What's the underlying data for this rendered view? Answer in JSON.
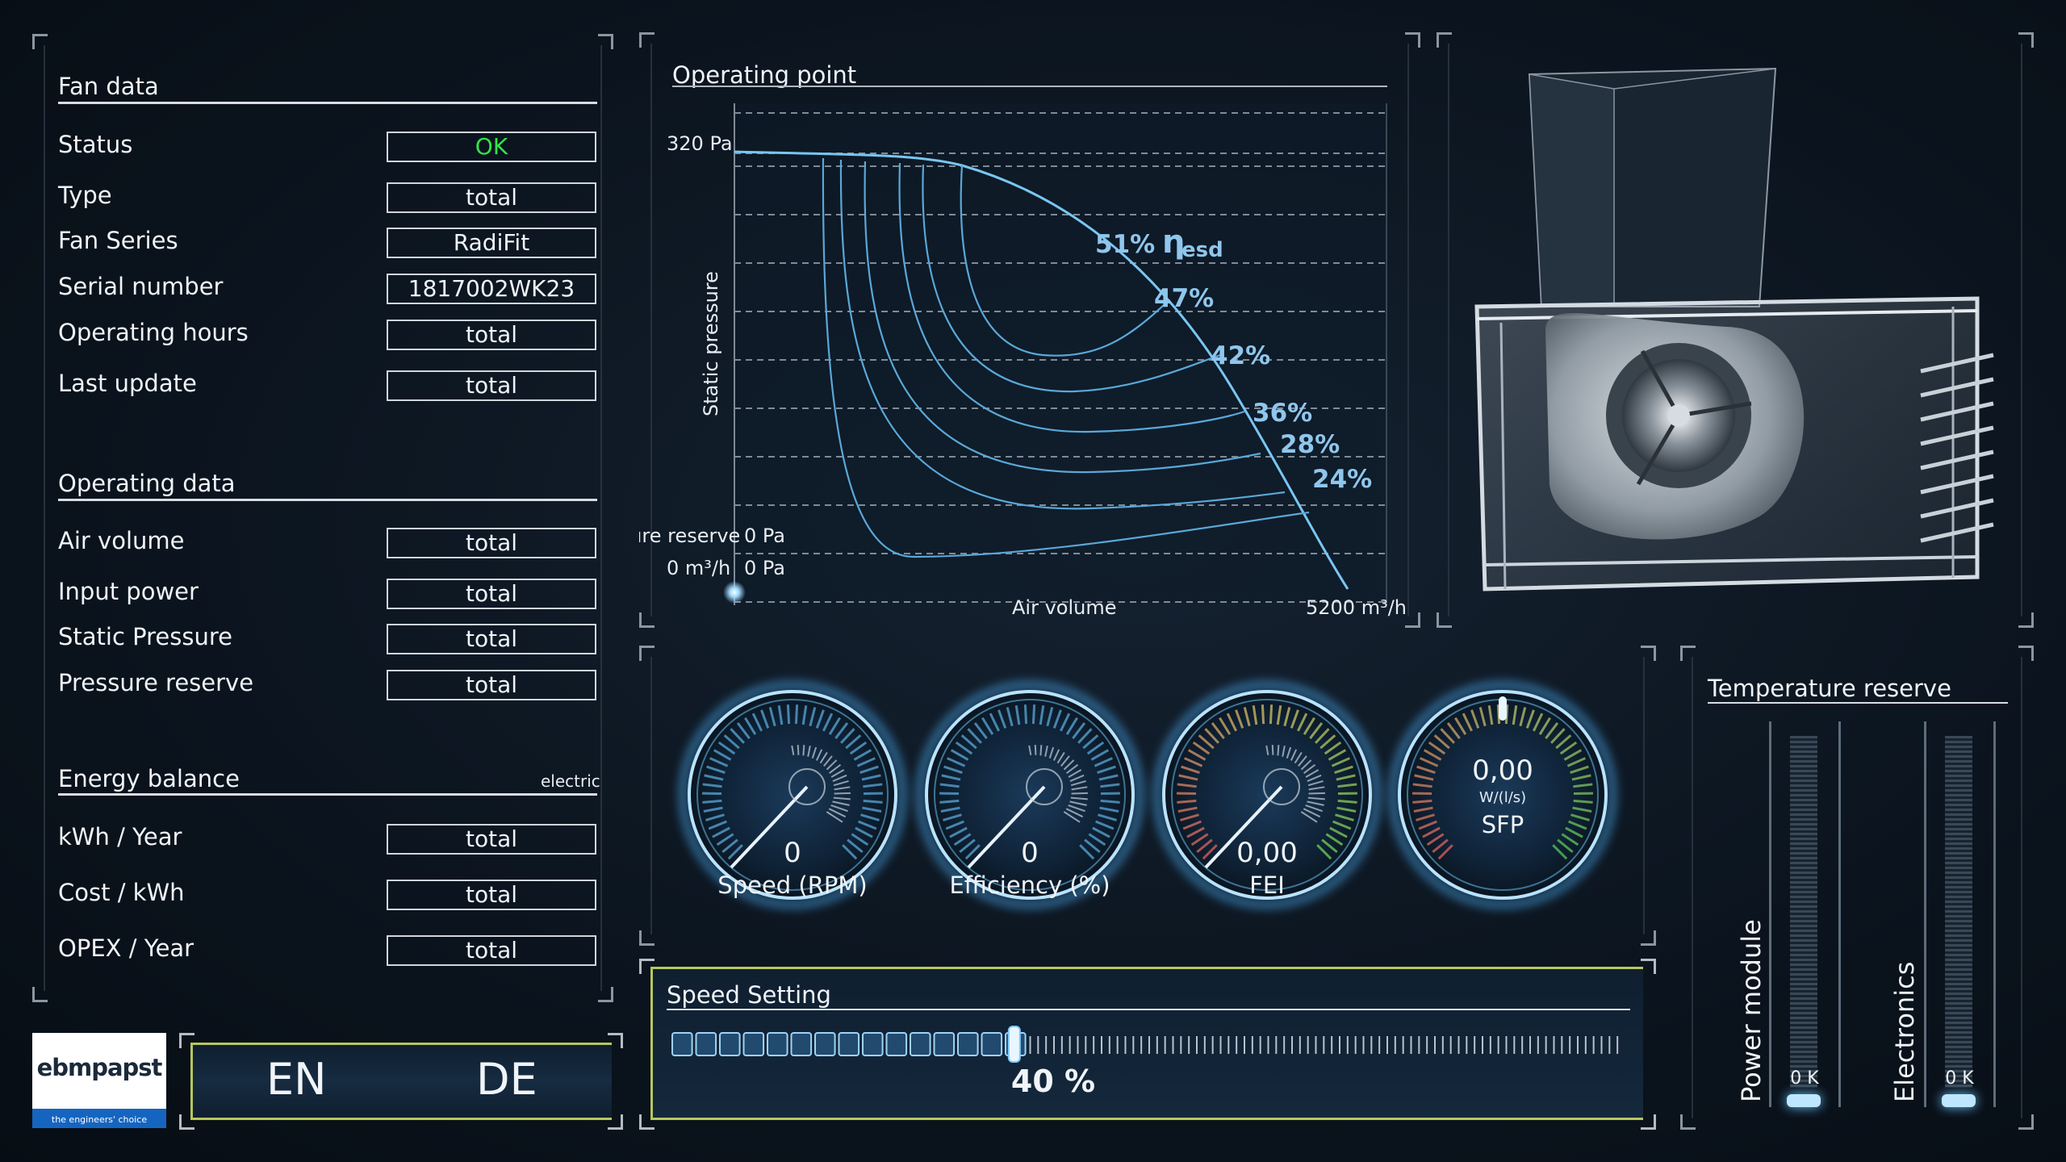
{
  "fan_data": {
    "title": "Fan data",
    "rows": [
      {
        "label": "Status",
        "value": "OK",
        "value_color": "#35e14a"
      },
      {
        "label": "Type",
        "value": "total"
      },
      {
        "label": "Fan Series",
        "value": "RadiFit"
      },
      {
        "label": "Serial number",
        "value": "1817002WK23"
      },
      {
        "label": "Operating hours",
        "value": "total"
      },
      {
        "label": "Last update",
        "value": "total"
      }
    ]
  },
  "operating_data": {
    "title": "Operating data",
    "rows": [
      {
        "label": "Air volume",
        "value": "total"
      },
      {
        "label": "Input power",
        "value": "total"
      },
      {
        "label": "Static Pressure",
        "value": "total"
      },
      {
        "label": "Pressure reserve",
        "value": "total"
      }
    ]
  },
  "energy_balance": {
    "title": "Energy balance",
    "note": "electric",
    "rows": [
      {
        "label": "kWh / Year",
        "value": "total"
      },
      {
        "label": "Cost / kWh",
        "value": "total"
      },
      {
        "label": "OPEX / Year",
        "value": "total"
      }
    ]
  },
  "logo": {
    "brand": "ebmpapst",
    "tagline": "the engineers' choice",
    "color": "#1565c0"
  },
  "language": {
    "en": "EN",
    "de": "DE"
  },
  "operating_point": {
    "title": "Operating point",
    "y_axis_label": "Static pressure",
    "x_axis_label": "Air volume",
    "y_max_label": "320 Pa",
    "x_max_label": "5200 m³/h",
    "pressure_reserve_label": "Pressure reserve",
    "pressure_reserve_value": "0 Pa",
    "current_air_volume": "0 m³/h",
    "current_pressure": "0 Pa",
    "efficiency_labels": [
      "51%",
      "47%",
      "42%",
      "36%",
      "28%",
      "24%"
    ],
    "eta_symbol": "η",
    "eta_subscript": "esd",
    "accent_color": "#6fb9e8"
  },
  "gauges": [
    {
      "label": "Speed (RPM)",
      "value": "0",
      "type": "speed"
    },
    {
      "label": "Efficiency (%)",
      "value": "0",
      "type": "efficiency"
    },
    {
      "label": "FEI",
      "value": "0,00",
      "type": "fei"
    },
    {
      "label": "SFP",
      "value": "0,00",
      "unit": "W/(l/s)",
      "type": "sfp"
    }
  ],
  "speed_setting": {
    "title": "Speed Setting",
    "value_label": "40 %",
    "fraction": 0.4,
    "accent_color": "#c9d86a"
  },
  "temperature_reserve": {
    "title": "Temperature reserve",
    "meters": [
      {
        "label": "Power module",
        "value": "0 K"
      },
      {
        "label": "Electronics",
        "value": "0 K"
      }
    ]
  }
}
